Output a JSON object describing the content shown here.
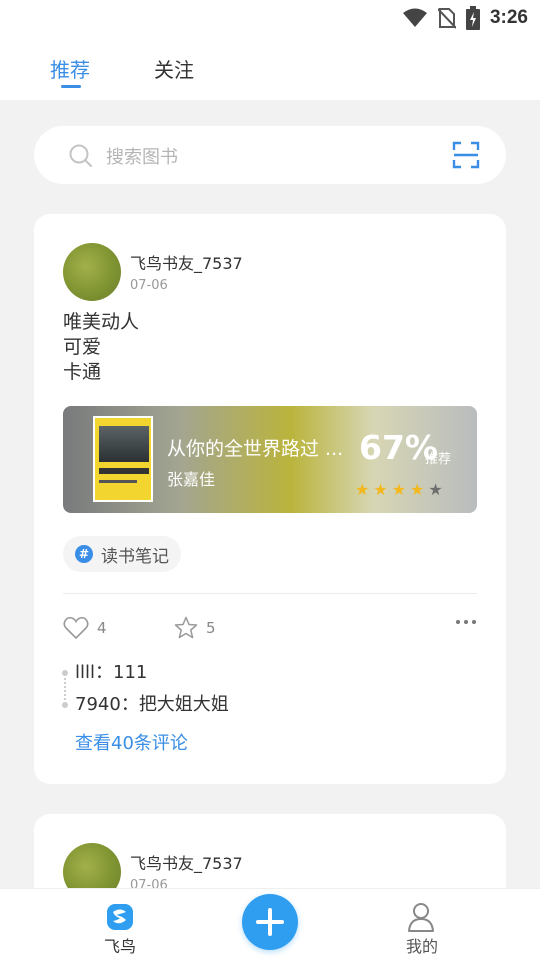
{
  "status": {
    "time": "3:26"
  },
  "tabs": {
    "recommend": "推荐",
    "follow": "关注"
  },
  "search": {
    "placeholder": "搜索图书"
  },
  "post": {
    "username": "飞鸟书友_7537",
    "date": "07-06",
    "lines": [
      "唯美动人",
      "可爱",
      "卡通"
    ],
    "book": {
      "title": "从你的全世界路过 ...",
      "author": "张嘉佳",
      "rating": "67%",
      "rating_label": "推荐",
      "stars": 4,
      "stars_total": 5
    },
    "tag": "读书笔记",
    "likes": "4",
    "favorites": "5",
    "comments": [
      {
        "user": "llll",
        "text": "111"
      },
      {
        "user": "7940",
        "text": "把大姐大姐"
      }
    ],
    "view_comments": "查看40条评论"
  },
  "post2": {
    "username": "飞鸟书友_7537",
    "date": "07-06"
  },
  "bottom_nav": {
    "home": "飞鸟",
    "mine": "我的"
  },
  "colors": {
    "accent": "#3a8ee6",
    "fab": "#2f9ef0"
  }
}
